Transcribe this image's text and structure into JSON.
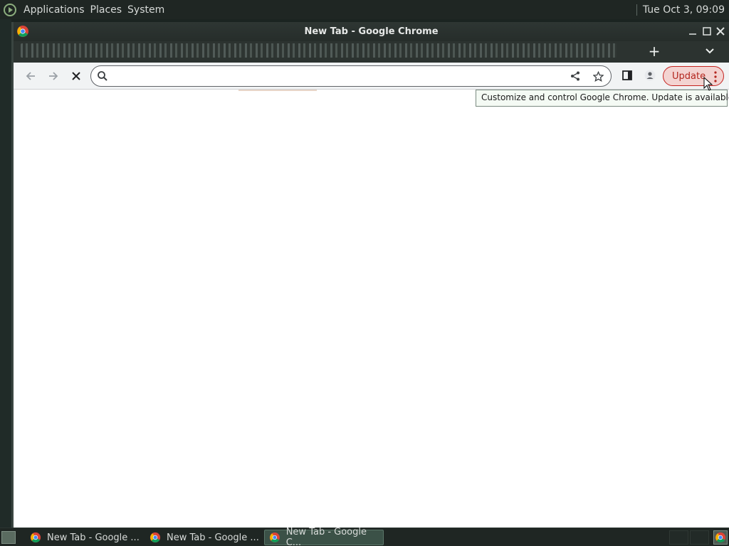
{
  "panel": {
    "menus": [
      "Applications",
      "Places",
      "System"
    ],
    "clock": "Tue Oct  3, 09:09"
  },
  "window": {
    "title": "New Tab - Google Chrome",
    "controls": [
      "minimize",
      "maximize",
      "close"
    ]
  },
  "tabstrip": {
    "new_tab_label": "+",
    "tab_search_label": "⌄"
  },
  "toolbar": {
    "omnibox_value": "",
    "update_label": "Update"
  },
  "tooltip": {
    "text": "Customize and control Google Chrome. Update is available."
  },
  "taskbar": {
    "tasks": [
      {
        "label": "New Tab - Google ...",
        "active": false
      },
      {
        "label": "New Tab - Google ...",
        "active": false
      },
      {
        "label": "New Tab - Google C...",
        "active": true
      }
    ]
  },
  "colors": {
    "update_accent": "#c5221f",
    "update_bg": "#f3d3d1",
    "panel_bg": "#1f2623",
    "active_task": "#3b5147"
  },
  "icons": [
    "distro-logo-icon",
    "chrome-icon",
    "back-arrow-icon",
    "forward-arrow-icon",
    "stop-icon",
    "search-icon",
    "share-icon",
    "bookmark-star-icon",
    "side-panel-icon",
    "profile-icon",
    "kebab-menu-icon",
    "mouse-cursor-icon"
  ]
}
